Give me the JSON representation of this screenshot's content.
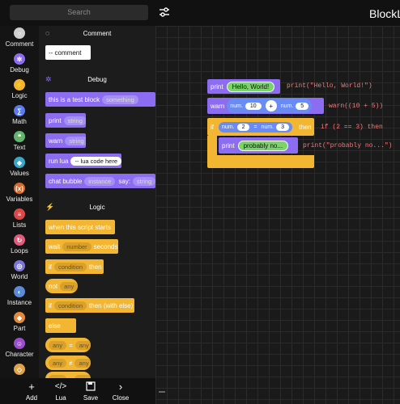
{
  "app": {
    "title": "BlockL",
    "search_placeholder": "Search"
  },
  "categories": [
    {
      "label": "Comment",
      "color": "#cfcfcf",
      "icon": "comment-icon",
      "glyph": "○"
    },
    {
      "label": "Debug",
      "color": "#8c6cf0",
      "icon": "bug-icon",
      "glyph": "✲"
    },
    {
      "label": "Logic",
      "color": "#f2b632",
      "icon": "logic-icon",
      "glyph": "⚡"
    },
    {
      "label": "Math",
      "color": "#5b7be8",
      "icon": "math-icon",
      "glyph": "∑"
    },
    {
      "label": "Text",
      "color": "#62b56b",
      "icon": "text-icon",
      "glyph": "❝"
    },
    {
      "label": "Values",
      "color": "#3aa6c8",
      "icon": "cube-icon",
      "glyph": "◈"
    },
    {
      "label": "Variables",
      "color": "#d36a2a",
      "icon": "variables-icon",
      "glyph": "(x)"
    },
    {
      "label": "Lists",
      "color": "#d84a4a",
      "icon": "list-icon",
      "glyph": "≡"
    },
    {
      "label": "Loops",
      "color": "#e35b7a",
      "icon": "loop-icon",
      "glyph": "↻"
    },
    {
      "label": "World",
      "color": "#7a76d6",
      "icon": "globe-icon",
      "glyph": "◎"
    },
    {
      "label": "Instance",
      "color": "#5c8bd6",
      "icon": "instance-icon",
      "glyph": "◐"
    },
    {
      "label": "Part",
      "color": "#e28a3a",
      "icon": "part-icon",
      "glyph": "◆"
    },
    {
      "label": "Character",
      "color": "#9b4ec8",
      "icon": "character-icon",
      "glyph": "☺"
    },
    {
      "label": "",
      "color": "#e0a34a",
      "icon": "more-icon",
      "glyph": "◇"
    }
  ],
  "flyout": {
    "comment": {
      "title": "Comment",
      "block": "-- comment"
    },
    "debug": {
      "title": "Debug",
      "test_block": "this is a test block",
      "test_slot": "something",
      "print": "print",
      "print_slot": "string",
      "warn": "warn",
      "warn_slot": "string",
      "runlua": "run lua",
      "runlua_slot": "-- lua code here",
      "chat": "chat bubble",
      "chat_slot1": "instance",
      "chat_say": "say:",
      "chat_slot2": "string"
    },
    "logic": {
      "title": "Logic",
      "when": "when this script starts",
      "wait": "wait",
      "wait_slot": "number",
      "wait_suffix": "seconds",
      "if1": "if",
      "if1_slot": "condition",
      "if1_then": "then",
      "not": "not",
      "not_slot": "any",
      "if2": "if",
      "if2_slot": "condition",
      "if2_then": "then (with else)",
      "else": "else",
      "cmp1_a": "any",
      "cmp1_op": "=",
      "cmp1_b": "any",
      "cmp2_a": "any",
      "cmp2_op": "≠",
      "cmp2_b": "any",
      "cmp3_a": "any",
      "cmp3_b": "any"
    }
  },
  "canvas": {
    "print_label": "print",
    "print_value": "Hello, World!",
    "print_code": "print(\"Hello, World!\")",
    "warn_label": "warn",
    "warn_num1_label": "num.",
    "warn_num1": "10",
    "warn_op": "+",
    "warn_num2_label": "num.",
    "warn_num2": "5",
    "warn_code": "warn((10 + 5))",
    "if_label": "if",
    "if_num1_label": "num.",
    "if_num1": "2",
    "if_op": "=",
    "if_num2_label": "num.",
    "if_num2": "3",
    "if_then": "then",
    "if_code": "if (2 == 3) then",
    "inner_print_label": "print",
    "inner_print_value": "probably no...",
    "inner_print_code": "print(\"probably no...\")"
  },
  "toolbar": {
    "add": "Add",
    "lua": "Lua",
    "save": "Save",
    "close": "Close"
  }
}
